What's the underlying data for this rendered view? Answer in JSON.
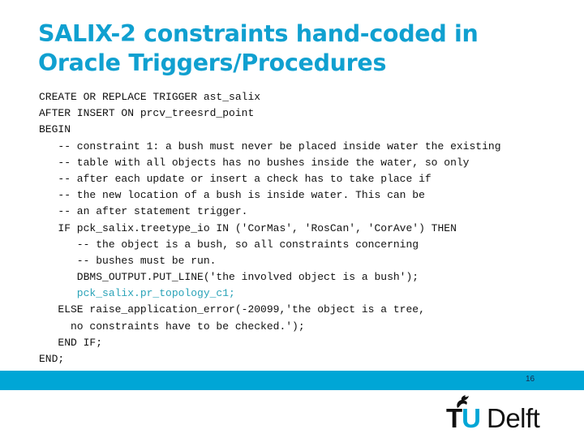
{
  "slide": {
    "title_lines": [
      "SALIX-2 constraints hand-coded in",
      "Oracle Triggers/Procedures"
    ],
    "code_lines": [
      "CREATE OR REPLACE TRIGGER ast_salix",
      "AFTER INSERT ON prcv_treesrd_point",
      "BEGIN",
      "   -- constraint 1: a bush must never be placed inside water the existing",
      "   -- table with all objects has no bushes inside the water, so only",
      "   -- after each update or insert a check has to take place if",
      "   -- the new location of a bush is inside water. This can be",
      "   -- an after statement trigger.",
      "   IF pck_salix.treetype_io IN ('CorMas', 'RosCan', 'CorAve') THEN",
      "      -- the object is a bush, so all constraints concerning",
      "      -- bushes must be run.",
      "      DBMS_OUTPUT.PUT_LINE('the involved object is a bush');",
      "      pck_salix.pr_topology_c1;",
      "   ELSE raise_application_error(-20099,'the object is a tree,",
      "     no constraints have to be checked.');",
      "   END IF;",
      "END;"
    ],
    "highlighted_line_index": 12,
    "page_number": "16",
    "accent_color": "#00a6d6",
    "logo": {
      "tu_t": "T",
      "tu_u": "U",
      "delft": "Delft",
      "icon": "flame-icon"
    }
  }
}
